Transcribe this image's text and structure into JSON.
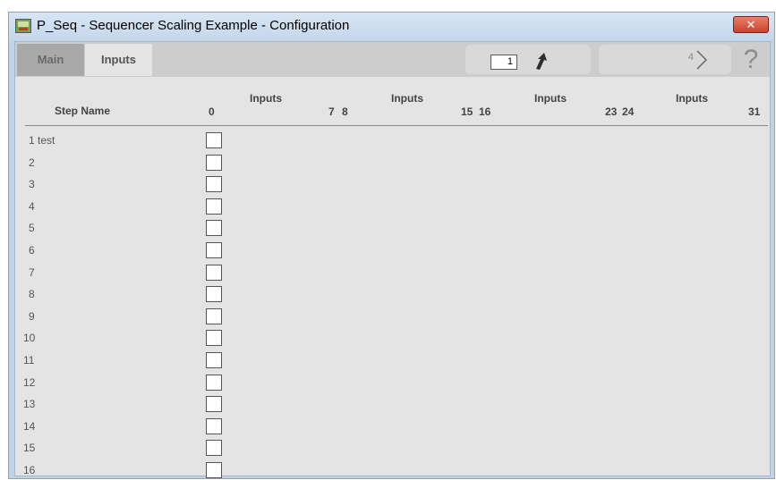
{
  "window": {
    "title": "P_Seq - Sequencer Scaling Example - Configuration",
    "close_label": "✕"
  },
  "tabs": [
    {
      "label": "Main",
      "active": false
    },
    {
      "label": "Inputs",
      "active": true
    }
  ],
  "toolbar": {
    "page_value": "1",
    "page_count": "4",
    "help_label": "?"
  },
  "table": {
    "step_name_header": "Step Name",
    "groups": [
      {
        "title": "Inputs",
        "start": "0",
        "end": "7"
      },
      {
        "title": "Inputs",
        "start": "8",
        "end": "15"
      },
      {
        "title": "Inputs",
        "start": "16",
        "end": "23"
      },
      {
        "title": "Inputs",
        "start": "24",
        "end": "31"
      }
    ],
    "rows": [
      {
        "num": "1",
        "name": "test"
      },
      {
        "num": "2",
        "name": ""
      },
      {
        "num": "3",
        "name": ""
      },
      {
        "num": "4",
        "name": ""
      },
      {
        "num": "5",
        "name": ""
      },
      {
        "num": "6",
        "name": ""
      },
      {
        "num": "7",
        "name": ""
      },
      {
        "num": "8",
        "name": ""
      },
      {
        "num": "9",
        "name": ""
      },
      {
        "num": "10",
        "name": ""
      },
      {
        "num": "11",
        "name": ""
      },
      {
        "num": "12",
        "name": ""
      },
      {
        "num": "13",
        "name": ""
      },
      {
        "num": "14",
        "name": ""
      },
      {
        "num": "15",
        "name": ""
      },
      {
        "num": "16",
        "name": ""
      }
    ]
  },
  "colors": {
    "accent_close": "#c8432d",
    "panel_bg": "#e4e4e4",
    "toolbar_bg": "#cdcdcd"
  }
}
